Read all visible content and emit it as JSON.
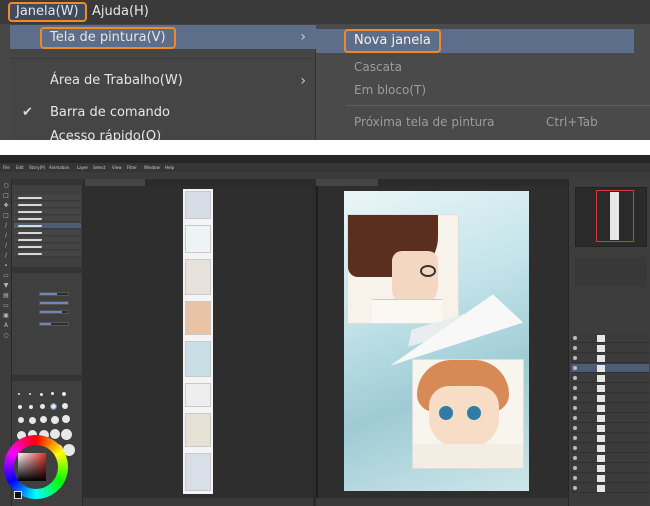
{
  "menubar": {
    "janela": "Janela(W)",
    "ajuda": "Ajuda(H)"
  },
  "window_menu": {
    "items": [
      {
        "label": "Tela de pintura(V)",
        "has_submenu": true,
        "highlighted": true
      },
      {
        "label": "Área de Trabalho(W)",
        "has_submenu": true
      },
      {
        "label": "Barra de comando",
        "checked": true
      },
      {
        "label": "Acesso rápido(Q)"
      }
    ]
  },
  "canvas_submenu": {
    "items": [
      {
        "label": "Nova janela",
        "highlighted": true
      },
      {
        "label": "Cascata",
        "disabled": true
      },
      {
        "label": "Em bloco(T)",
        "disabled": true
      },
      {
        "label": "Próxima tela de pintura",
        "shortcut": "Ctrl+Tab",
        "disabled": true
      }
    ]
  },
  "app": {
    "menu_items": [
      "File",
      "Edit",
      "Story(P)",
      "Animation",
      "Layer",
      "Select",
      "View",
      "Filter",
      "Window",
      "Help"
    ]
  },
  "colors": {
    "highlight_orange": "#f08a24",
    "menu_highlight": "#5d6e8b",
    "menu_bg": "#454545"
  },
  "icons": [
    "checkmark-icon",
    "chevron-right-icon",
    "paper-airplane-illustration"
  ]
}
